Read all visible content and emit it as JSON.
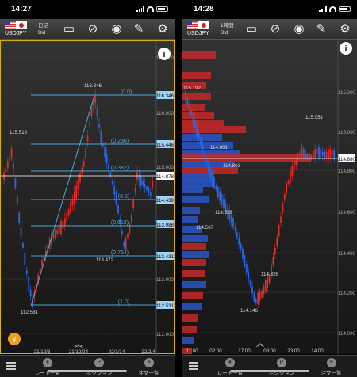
{
  "left": {
    "status": {
      "time": "14:27"
    },
    "toolbar": {
      "pair": "USDJPY",
      "timeframe": "日足",
      "price_type": "Bid"
    },
    "price_axis": [
      "117.000",
      "116.346",
      "116.000",
      "115.446",
      "115.000",
      "114.878",
      "114.439",
      "113.988",
      "113.431",
      "113.000",
      "112.531",
      "112.000"
    ],
    "fib_levels": [
      "(0.0)",
      "(0.236)",
      "(0.382)",
      "(0.5)",
      "(0.618)",
      "(0.764)",
      "(1.0)"
    ],
    "annotations": [
      "116.346",
      "115.519",
      "113.472",
      "112.531"
    ],
    "current_price": "114.878",
    "time_axis": [
      "21/12/3",
      "21/12/24",
      "22/1/14",
      "22/2/4"
    ],
    "badge": "¥",
    "nav": {
      "rate": "レート一覧",
      "position": "ポジション",
      "orders": "注文一覧"
    }
  },
  "right": {
    "status": {
      "time": "14:28"
    },
    "toolbar": {
      "pair": "USDJPY",
      "timeframe": "1時間",
      "price_type": "Bid"
    },
    "price_axis": [
      "115.200",
      "115.000",
      "114.880",
      "114.800",
      "114.600",
      "114.400",
      "114.200",
      "114.000"
    ],
    "annotations": [
      "115.192",
      "115.051",
      "114.891",
      "114.803",
      "114.628",
      "114.567",
      "114.326",
      "114.146"
    ],
    "current_price": "114.880",
    "time_axis": [
      "11:00",
      "02:00",
      "17:00",
      "08:00",
      "23:00",
      "14:00"
    ],
    "nav": {
      "rate": "レート一覧",
      "position": "ポジション",
      "orders": "注文一覧"
    }
  },
  "colors": {
    "up": "#e52b2b",
    "down": "#2b67e5",
    "fib": "#4aa8d8",
    "current": "#ffffff",
    "border": "#d4b000"
  }
}
